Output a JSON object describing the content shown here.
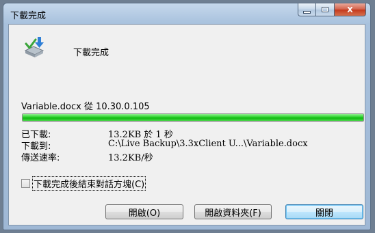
{
  "window": {
    "title": "下載完成",
    "controls": {
      "minimize_icon": "minimize-icon",
      "maximize_icon": "maximize-icon",
      "close_icon": "close-icon",
      "close_glyph": "X"
    }
  },
  "main": {
    "icon": "download-complete-icon",
    "heading": "下載完成",
    "source_line": "Variable.docx 從 10.30.0.105",
    "progress_percent": 100,
    "progress_color": "#22c922",
    "details": [
      {
        "label": "已下載:",
        "value": "13.2KB 於 1 秒"
      },
      {
        "label": "下載到:",
        "value": "C:\\Live Backup\\3.3xClient U...\\Variable.docx"
      },
      {
        "label": "傳送速率:",
        "value": "13.2KB/秒"
      }
    ],
    "close_on_complete_label": "下載完成後結束對話方塊(C)",
    "close_on_complete_checked": false
  },
  "buttons": {
    "open": "開啟(O)",
    "open_folder": "開啟資料夾(F)",
    "close": "關閉"
  }
}
